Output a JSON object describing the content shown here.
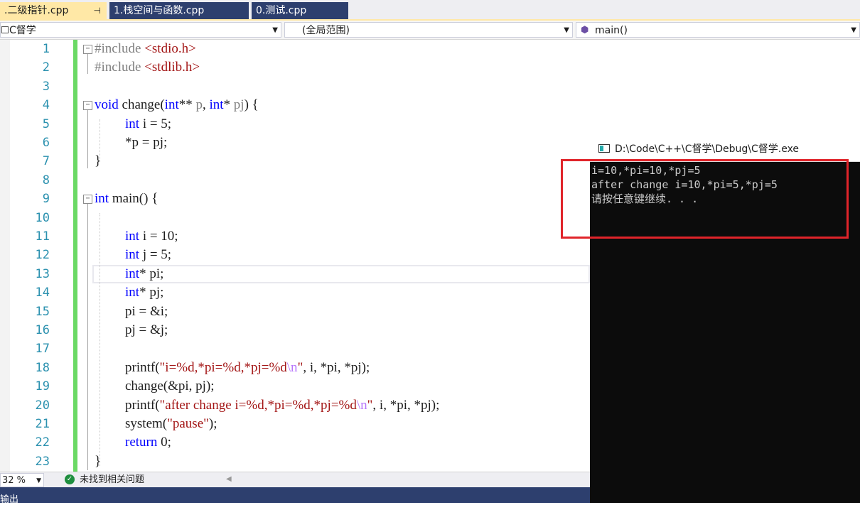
{
  "tabs": [
    {
      "label": ".二级指针.cpp",
      "pin": "⊣",
      "active": true
    },
    {
      "label": "1.栈空间与函数.cpp",
      "active": false
    },
    {
      "label": "0.测试.cpp",
      "active": false
    }
  ],
  "nav": {
    "project": "C督学",
    "scope": "(全局范围)",
    "member": "main()"
  },
  "lines": [
    {
      "n": "1"
    },
    {
      "n": "2"
    },
    {
      "n": "3"
    },
    {
      "n": "4"
    },
    {
      "n": "5"
    },
    {
      "n": "6"
    },
    {
      "n": "7"
    },
    {
      "n": "8"
    },
    {
      "n": "9"
    },
    {
      "n": "10"
    },
    {
      "n": "11"
    },
    {
      "n": "12"
    },
    {
      "n": "13"
    },
    {
      "n": "14"
    },
    {
      "n": "15"
    },
    {
      "n": "16"
    },
    {
      "n": "17"
    },
    {
      "n": "18"
    },
    {
      "n": "19"
    },
    {
      "n": "20"
    },
    {
      "n": "21"
    },
    {
      "n": "22"
    },
    {
      "n": "23"
    }
  ],
  "code": {
    "l1": {
      "directive": "#include ",
      "header": "<stdio.h>"
    },
    "l2": {
      "directive": "#include ",
      "header": "<stdlib.h>"
    },
    "l4": {
      "kw": "void",
      "name": " change(",
      "t1": "int",
      "a1": "** ",
      "p1": "p",
      "a2": ", ",
      "t2": "int",
      "a3": "* ",
      "p2": "pj",
      "a4": ") {"
    },
    "l5": {
      "kw": "int",
      "rest": " i = 5;"
    },
    "l6": {
      "rest": "*p = pj;"
    },
    "l7": {
      "rest": "}"
    },
    "l9": {
      "kw": "int",
      "rest": " main() {"
    },
    "l11": {
      "kw": "int",
      "rest": " i = 10;"
    },
    "l12": {
      "kw": "int",
      "rest": " j = 5;"
    },
    "l13": {
      "kw": "int",
      "rest": "* pi;"
    },
    "l14": {
      "kw": "int",
      "rest": "* pj;"
    },
    "l15": {
      "rest": "pi = &i;"
    },
    "l16": {
      "rest": "pj = &j;"
    },
    "l18": {
      "fn": "printf(",
      "str1": "\"i=%d,*pi=%d,*pj=%d",
      "esc": "\\n",
      "str2": "\"",
      "rest": ", i, *pi, *pj);"
    },
    "l19": {
      "rest": "change(&pi, pj);"
    },
    "l20": {
      "fn": "printf(",
      "str1": "\"after change i=%d,*pi=%d,*pj=%d",
      "esc": "\\n",
      "str2": "\"",
      "rest": ", i, *pi, *pj);"
    },
    "l21": {
      "fn": "system(",
      "str": "\"pause\"",
      "rest": ");"
    },
    "l22": {
      "kw": "return",
      "rest": " 0;"
    },
    "l23": {
      "rest": "}"
    }
  },
  "status": {
    "zoom": "32 %",
    "issues": "未找到相关问题",
    "output_label": "输出"
  },
  "console": {
    "title": "D:\\Code\\C++\\C督学\\Debug\\C督学.exe",
    "lines": [
      "i=10,*pi=10,*pj=5",
      "after change i=10,*pi=5,*pj=5",
      "请按任意键继续. . ."
    ]
  },
  "colors": {
    "active_tab": "#ffe8a6",
    "inactive_tab": "#2d3f6e",
    "change_bar": "#6bd965",
    "highlight_box": "#e0242a"
  }
}
